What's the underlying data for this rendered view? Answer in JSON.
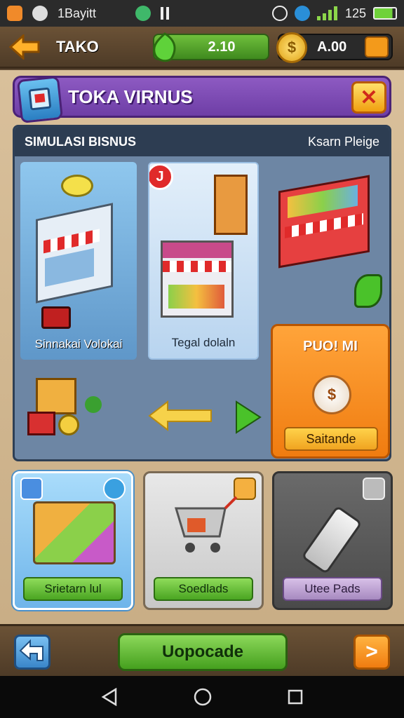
{
  "status_bar": {
    "carrier": "1Bayitt",
    "battery_text": "125",
    "icons": [
      "app-icon",
      "alien-icon",
      "shuffle-icon",
      "signal-bars-icon",
      "alarm-icon",
      "chat-icon",
      "signal-icon",
      "battery-icon"
    ]
  },
  "top_bar": {
    "title": "TAKO",
    "gems_value": "2.10",
    "coins_value": "A.00",
    "coin_symbol": "$"
  },
  "header": {
    "title": "TOKA VIRNUS",
    "close_symbol": "✕"
  },
  "board": {
    "left_heading": "SIMULASI BISNUS",
    "right_heading": "Ksarn Pleige",
    "cards": [
      {
        "label": "Sinnakai Volokai"
      },
      {
        "label": "Tegal dolaln",
        "badge": "J"
      },
      {
        "label": ""
      }
    ],
    "feature": {
      "title": "PUO! MI",
      "button": "Saitande",
      "icon_text": "$"
    }
  },
  "tiles": [
    {
      "button": "Srietarn lul"
    },
    {
      "button": "Soedlads"
    },
    {
      "button": "Utee Pads"
    }
  ],
  "bottom_bar": {
    "main_button": "Uopocade",
    "next_symbol": ">"
  },
  "colors": {
    "purple_header": "#7a48b2",
    "orange_feature": "#f28a1c",
    "green_button": "#5ab32c",
    "blue_tile": "#8bcaf5"
  }
}
